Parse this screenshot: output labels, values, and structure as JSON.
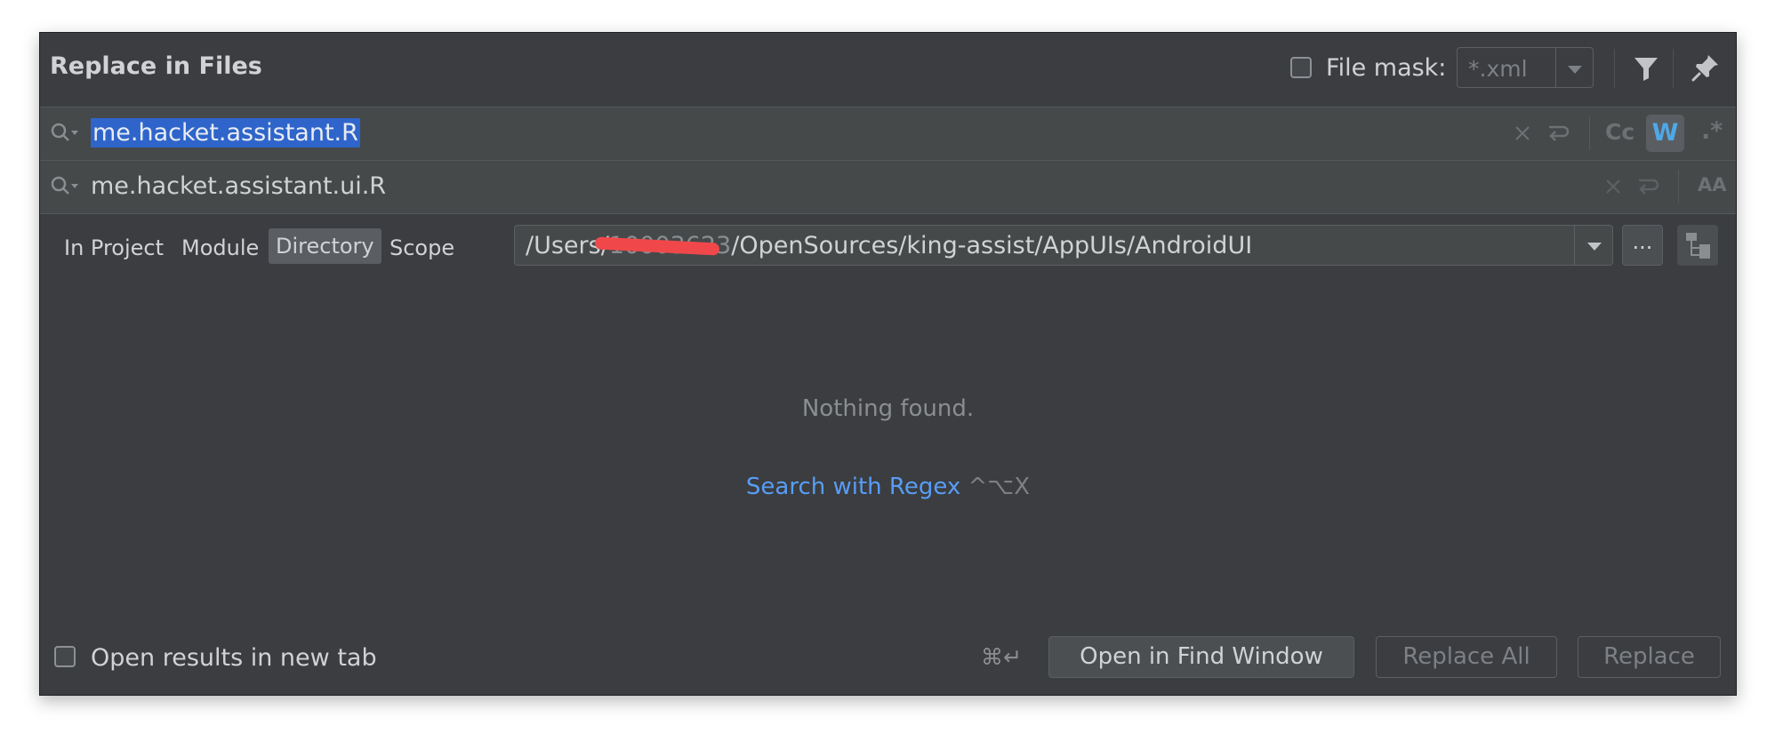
{
  "dialog": {
    "title": "Replace in Files"
  },
  "header": {
    "file_mask_checked": false,
    "file_mask_label": "File mask:",
    "file_mask_value": "*.xml",
    "filter_icon": "filter-icon",
    "pin_icon": "pin-icon"
  },
  "search": {
    "find_value": "me.hacket.assistant.R",
    "replace_value": "me.hacket.assistant.ui.R",
    "options": {
      "match_case_label": "Cc",
      "match_case_active": false,
      "words_label": "W",
      "words_active": true,
      "regex_label": ".*",
      "regex_active": false,
      "preserve_case_label": "AA"
    }
  },
  "scope": {
    "tabs": [
      {
        "label": "In Project",
        "active": false
      },
      {
        "label": "Module",
        "active": false
      },
      {
        "label": "Directory",
        "active": true
      },
      {
        "label": "Scope",
        "active": false
      }
    ],
    "directory_prefix": "/Users/",
    "directory_redacted": "10003623",
    "directory_suffix": "/OpenSources/king-assist/AppUIs/AndroidUI",
    "browse_label": "..."
  },
  "results": {
    "empty_message": "Nothing found.",
    "regex_link": "Search with Regex",
    "regex_shortcut": "^⌥X"
  },
  "footer": {
    "open_new_tab_checked": false,
    "open_new_tab_label": "Open results in new tab",
    "shortcut_hint": "⌘↵",
    "open_find_window": "Open in Find Window",
    "replace_all": "Replace All",
    "replace": "Replace"
  },
  "colors": {
    "background": "#3b3d40",
    "selection": "#2f65ca",
    "link": "#589df6",
    "redaction": "#f0484a"
  }
}
